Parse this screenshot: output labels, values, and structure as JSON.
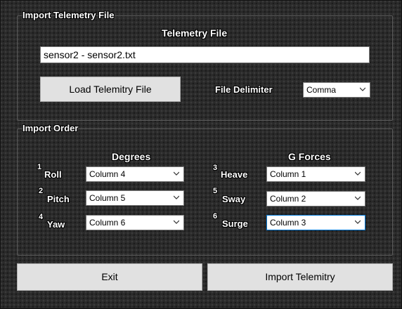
{
  "telemetry_group": {
    "title": "Import Telemetry File",
    "file_label": "Telemetry File",
    "file_path": "sensor2 - sensor2.txt",
    "load_button": "Load Telemitry File",
    "delimiter_label": "File Delimiter",
    "delimiter_value": "Comma"
  },
  "import_order": {
    "title": "Import Order",
    "degrees_header": "Degrees",
    "gforces_header": "G Forces",
    "degrees": [
      {
        "num": "1",
        "label": "Roll",
        "value": "Column 4"
      },
      {
        "num": "2",
        "label": "Pitch",
        "value": "Column 5"
      },
      {
        "num": "4",
        "label": "Yaw",
        "value": "Column 6"
      }
    ],
    "gforces": [
      {
        "num": "3",
        "label": "Heave",
        "value": "Column 1"
      },
      {
        "num": "5",
        "label": "Sway",
        "value": "Column 2"
      },
      {
        "num": "6",
        "label": "Surge",
        "value": "Column 3"
      }
    ]
  },
  "footer": {
    "exit_button": "Exit",
    "import_button": "Import Telemitry"
  },
  "icons": {
    "dropdown": "chevron-down-icon"
  }
}
